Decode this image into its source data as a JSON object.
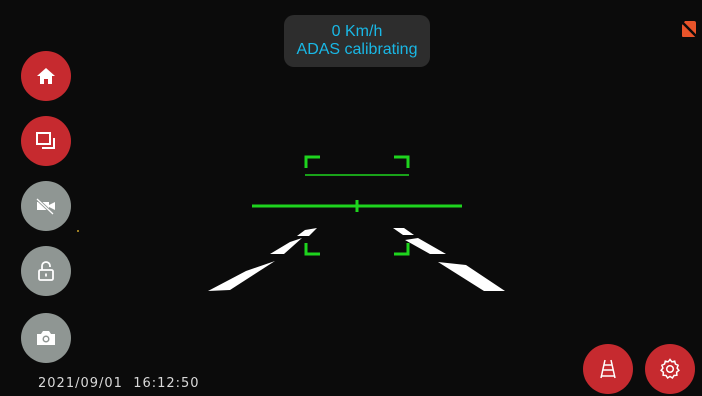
{
  "status": {
    "speed": "0 Km/h",
    "message": "ADAS calibrating"
  },
  "datetime": "2021/09/01  16:12:50",
  "colors": {
    "accent_red": "#c62a2f",
    "disabled_gray": "#8f9693",
    "status_text": "#19b8e6",
    "guide_green": "#1ed41e",
    "lane_white": "#ffffff",
    "sd_error_orange": "#e8542a"
  },
  "left_toolbar": [
    {
      "name": "home-button",
      "icon": "home-icon",
      "state": "active"
    },
    {
      "name": "switch-view-button",
      "icon": "dual-screen-icon",
      "state": "active"
    },
    {
      "name": "record-toggle-button",
      "icon": "camera-off-icon",
      "state": "disabled"
    },
    {
      "name": "lock-button",
      "icon": "unlock-icon",
      "state": "disabled"
    },
    {
      "name": "snapshot-button",
      "icon": "camera-icon",
      "state": "disabled"
    }
  ],
  "right_toolbar": [
    {
      "name": "adas-button",
      "icon": "lane-road-icon"
    },
    {
      "name": "settings-button",
      "icon": "gear-icon"
    }
  ],
  "indicators": {
    "sd_card": "sd-card-error-icon"
  }
}
